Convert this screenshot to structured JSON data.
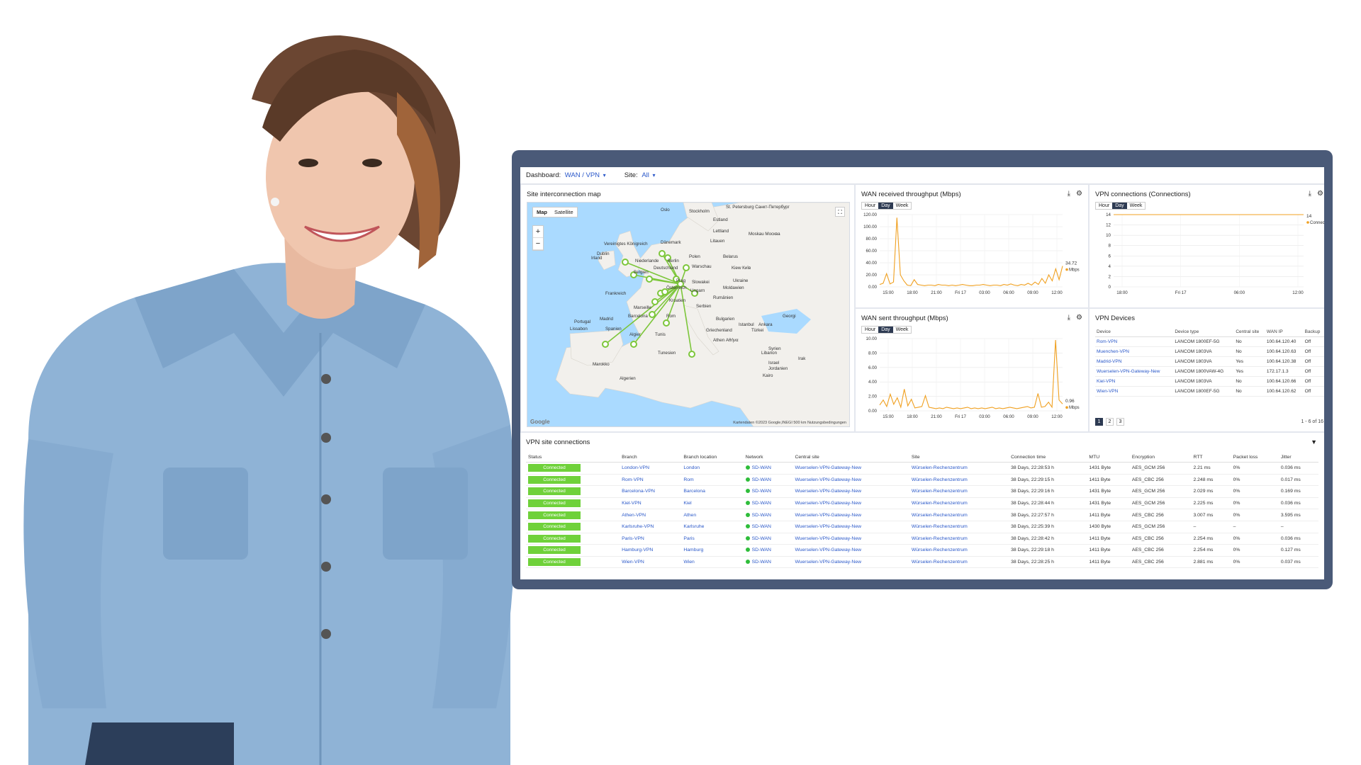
{
  "topbar": {
    "dashboard_label": "Dashboard:",
    "dashboard_value": "WAN / VPN",
    "site_label": "Site:",
    "site_value": "All"
  },
  "map": {
    "title": "Site interconnection map",
    "toggle_map": "Map",
    "toggle_satellite": "Satellite",
    "zoom_in": "+",
    "zoom_out": "−",
    "footer": "Kartendaten ©2023 Google,INEGI   500 km   Nutzungsbedingungen",
    "logo": "Google",
    "labels": [
      {
        "name": "Oslo"
      },
      {
        "name": "Stockholm"
      },
      {
        "name": "St. Petersburg Санкт-Петербург"
      },
      {
        "name": "Estland"
      },
      {
        "name": "Lettland"
      },
      {
        "name": "Moskau Москва"
      },
      {
        "name": "Litauen"
      },
      {
        "name": "Dänemark"
      },
      {
        "name": "Vereinigtes Königreich"
      },
      {
        "name": "Irland"
      },
      {
        "name": "Dublin"
      },
      {
        "name": "Niederlande"
      },
      {
        "name": "Berlin"
      },
      {
        "name": "Polen"
      },
      {
        "name": "Belarus"
      },
      {
        "name": "Warschau"
      },
      {
        "name": "Kiew Київ"
      },
      {
        "name": "Belgien"
      },
      {
        "name": "Deutschland"
      },
      {
        "name": "Prag"
      },
      {
        "name": "Slowakei"
      },
      {
        "name": "Ukraine"
      },
      {
        "name": "Frankreich"
      },
      {
        "name": "Österreich"
      },
      {
        "name": "Ungarn"
      },
      {
        "name": "Moldawien"
      },
      {
        "name": "Rumänien"
      },
      {
        "name": "Kroatien"
      },
      {
        "name": "Serbien"
      },
      {
        "name": "Marseille"
      },
      {
        "name": "Portugal"
      },
      {
        "name": "Madrid"
      },
      {
        "name": "Spanien"
      },
      {
        "name": "Lissabon"
      },
      {
        "name": "Barcelona"
      },
      {
        "name": "Rom"
      },
      {
        "name": "Bulgarien"
      },
      {
        "name": "Istanbul"
      },
      {
        "name": "Ankara"
      },
      {
        "name": "Türkei"
      },
      {
        "name": "Georgi"
      },
      {
        "name": "Griechenland"
      },
      {
        "name": "Athen Αθήνα"
      },
      {
        "name": "Algier"
      },
      {
        "name": "Tunis"
      },
      {
        "name": "Tunesien"
      },
      {
        "name": "Syrien"
      },
      {
        "name": "Libanon"
      },
      {
        "name": "Irak"
      },
      {
        "name": "Israel"
      },
      {
        "name": "Jordanien"
      },
      {
        "name": "Marokko"
      },
      {
        "name": "Algerien"
      },
      {
        "name": "Kairo"
      }
    ]
  },
  "wan_rx": {
    "title": "WAN received throughput (Mbps)",
    "tabs": [
      "Hour",
      "Day",
      "Week"
    ],
    "active_tab": "Day",
    "y_ticks": [
      "120.00",
      "100.00",
      "80.00",
      "60.00",
      "40.00",
      "20.00",
      "0.00"
    ],
    "x_ticks": [
      "15:00",
      "18:00",
      "21:00",
      "Fri 17",
      "03:00",
      "06:00",
      "09:00",
      "12:00"
    ],
    "current_value": "34.72",
    "legend": "Mbps",
    "values": [
      4,
      6,
      22,
      5,
      8,
      115,
      20,
      10,
      3,
      2,
      12,
      4,
      3,
      2,
      3,
      3,
      2,
      4,
      3,
      3,
      2,
      3,
      2,
      3,
      4,
      3,
      2,
      2,
      3,
      3,
      4,
      3,
      2,
      3,
      3,
      2,
      4,
      3,
      5,
      3,
      2,
      4,
      3,
      6,
      3,
      8,
      4,
      14,
      6,
      20,
      10,
      30,
      12,
      34.72
    ],
    "ymax": 120
  },
  "vpn_conn": {
    "title": "VPN connections (Connections)",
    "tabs": [
      "Hour",
      "Day",
      "Week"
    ],
    "active_tab": "Day",
    "y_ticks": [
      "14",
      "12",
      "10",
      "8",
      "6",
      "4",
      "2",
      "0"
    ],
    "x_ticks": [
      "18:00",
      "Fri 17",
      "06:00",
      "12:00"
    ],
    "current_value": "14",
    "legend": "Connections",
    "values": [
      14,
      14,
      14,
      14,
      14,
      14,
      14,
      14,
      14,
      14,
      14,
      14,
      14,
      14,
      14,
      14,
      14,
      14,
      14,
      14
    ],
    "ymax": 14
  },
  "wan_tx": {
    "title": "WAN sent throughput (Mbps)",
    "tabs": [
      "Hour",
      "Day",
      "Week"
    ],
    "active_tab": "Day",
    "y_ticks": [
      "10.00",
      "8.00",
      "6.00",
      "4.00",
      "2.00",
      "0.00"
    ],
    "x_ticks": [
      "15:00",
      "18:00",
      "21:00",
      "Fri 17",
      "03:00",
      "06:00",
      "09:00",
      "12:00"
    ],
    "current_value": "0.96",
    "legend": "Mbps",
    "values": [
      0.8,
      1.5,
      0.6,
      2.3,
      0.9,
      1.8,
      0.5,
      3.0,
      0.7,
      1.6,
      0.4,
      0.5,
      0.6,
      2.1,
      0.5,
      0.4,
      0.3,
      0.4,
      0.3,
      0.5,
      0.4,
      0.3,
      0.4,
      0.3,
      0.4,
      0.5,
      0.3,
      0.4,
      0.3,
      0.4,
      0.3,
      0.4,
      0.5,
      0.3,
      0.4,
      0.3,
      0.4,
      0.5,
      0.4,
      0.3,
      0.4,
      0.5,
      0.6,
      0.4,
      0.5,
      2.4,
      0.5,
      0.6,
      1.2,
      0.5,
      9.8,
      1.5,
      0.96
    ],
    "ymax": 10
  },
  "devices": {
    "title": "VPN Devices",
    "headers": [
      "Device",
      "Device type",
      "Central site",
      "WAN IP",
      "Backup"
    ],
    "rows": [
      [
        "Rom-VPN",
        "LANCOM 1800EF-5G",
        "No",
        "100.64.120.40",
        "Off"
      ],
      [
        "Muenchen-VPN",
        "LANCOM 1803VA",
        "No",
        "100.64.120.63",
        "Off"
      ],
      [
        "Madrid-VPN",
        "LANCOM 1803VA",
        "Yes",
        "100.64.120.38",
        "Off"
      ],
      [
        "Wuerselen-VPN-Gateway-New",
        "LANCOM 1800VAW-4G",
        "Yes",
        "172.17.1.3",
        "Off"
      ],
      [
        "Kiel-VPN",
        "LANCOM 1803VA",
        "No",
        "100.64.120.66",
        "Off"
      ],
      [
        "Wien-VPN",
        "LANCOM 1800EF-5G",
        "No",
        "100.64.120.62",
        "Off"
      ]
    ],
    "pages": [
      "1",
      "2",
      "3"
    ],
    "active_page": "1",
    "pager_info": "1 - 6 of 16"
  },
  "sites": {
    "title": "VPN site connections",
    "headers": [
      "Status",
      "Branch",
      "Branch location",
      "Network",
      "Central site",
      "Site",
      "Connection time",
      "MTU",
      "Encryption",
      "RTT",
      "Packet loss",
      "Jitter"
    ],
    "rows": [
      [
        "Connected",
        "London-VPN",
        "London",
        "SD-WAN",
        "Wuerselen-VPN-Gateway-New",
        "Würselen-Rechenzentrum",
        "38 Days, 22:28:53 h",
        "1431 Byte",
        "AES_GCM 256",
        "2.21 ms",
        "0%",
        "0.036 ms"
      ],
      [
        "Connected",
        "Rom-VPN",
        "Rom",
        "SD-WAN",
        "Wuerselen-VPN-Gateway-New",
        "Würselen-Rechenzentrum",
        "38 Days, 22:29:15 h",
        "1411 Byte",
        "AES_CBC 256",
        "2.248 ms",
        "0%",
        "0.017 ms"
      ],
      [
        "Connected",
        "Barcelona-VPN",
        "Barcelona",
        "SD-WAN",
        "Wuerselen-VPN-Gateway-New",
        "Würselen-Rechenzentrum",
        "38 Days, 22:29:16 h",
        "1431 Byte",
        "AES_GCM 256",
        "2.029 ms",
        "0%",
        "0.169 ms"
      ],
      [
        "Connected",
        "Kiel-VPN",
        "Kiel",
        "SD-WAN",
        "Wuerselen-VPN-Gateway-New",
        "Würselen-Rechenzentrum",
        "38 Days, 22:28:44 h",
        "1431 Byte",
        "AES_GCM 256",
        "2.225 ms",
        "0%",
        "0.036 ms"
      ],
      [
        "Connected",
        "Athen-VPN",
        "Athen",
        "SD-WAN",
        "Wuerselen-VPN-Gateway-New",
        "Würselen-Rechenzentrum",
        "38 Days, 22:27:57 h",
        "1411 Byte",
        "AES_CBC 256",
        "3.007 ms",
        "0%",
        "3.595 ms"
      ],
      [
        "Connected",
        "Karlsruhe-VPN",
        "Karlsruhe",
        "SD-WAN",
        "Wuerselen-VPN-Gateway-New",
        "Würselen-Rechenzentrum",
        "38 Days, 22:25:39 h",
        "1430 Byte",
        "AES_GCM 256",
        "–",
        "–",
        "–"
      ],
      [
        "Connected",
        "Paris-VPN",
        "Paris",
        "SD-WAN",
        "Wuerselen-VPN-Gateway-New",
        "Würselen-Rechenzentrum",
        "38 Days, 22:28:42 h",
        "1411 Byte",
        "AES_CBC 256",
        "2.254 ms",
        "0%",
        "0.036 ms"
      ],
      [
        "Connected",
        "Hamburg-VPN",
        "Hamburg",
        "SD-WAN",
        "Wuerselen-VPN-Gateway-New",
        "Würselen-Rechenzentrum",
        "38 Days, 22:29:18 h",
        "1411 Byte",
        "AES_CBC 256",
        "2.254 ms",
        "0%",
        "0.127 ms"
      ],
      [
        "Connected",
        "Wien-VPN",
        "Wien",
        "SD-WAN",
        "Wuerselen-VPN-Gateway-New",
        "Würselen-Rechenzentrum",
        "38 Days, 22:28:25 h",
        "1411 Byte",
        "AES_CBC 256",
        "2.881 ms",
        "0%",
        "0.037 ms"
      ]
    ]
  },
  "colors": {
    "frame": "#4a5a78",
    "link": "#2a58c9",
    "connected": "#6fd13a",
    "chart_line": "#f0a020",
    "map_water": "#aadaff",
    "map_land": "#f2f0ec",
    "map_links": "#7cc63a"
  }
}
